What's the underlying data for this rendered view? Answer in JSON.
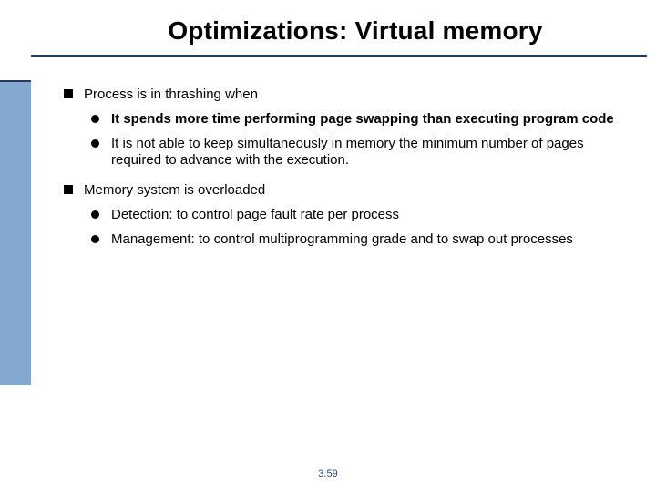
{
  "title": "Optimizations: Virtual memory",
  "content": {
    "b1": {
      "text": "Process is in thrashing when",
      "sub": [
        "It spends more time performing page swapping than executing program code",
        "It is not able to keep simultaneously in memory the minimum number of pages required to advance with the execution."
      ]
    },
    "b2": {
      "text": "Memory system is overloaded",
      "sub": [
        "Detection: to control page fault rate per process",
        "Management: to control multiprogramming grade and to swap out processes"
      ]
    }
  },
  "page": "3.59"
}
